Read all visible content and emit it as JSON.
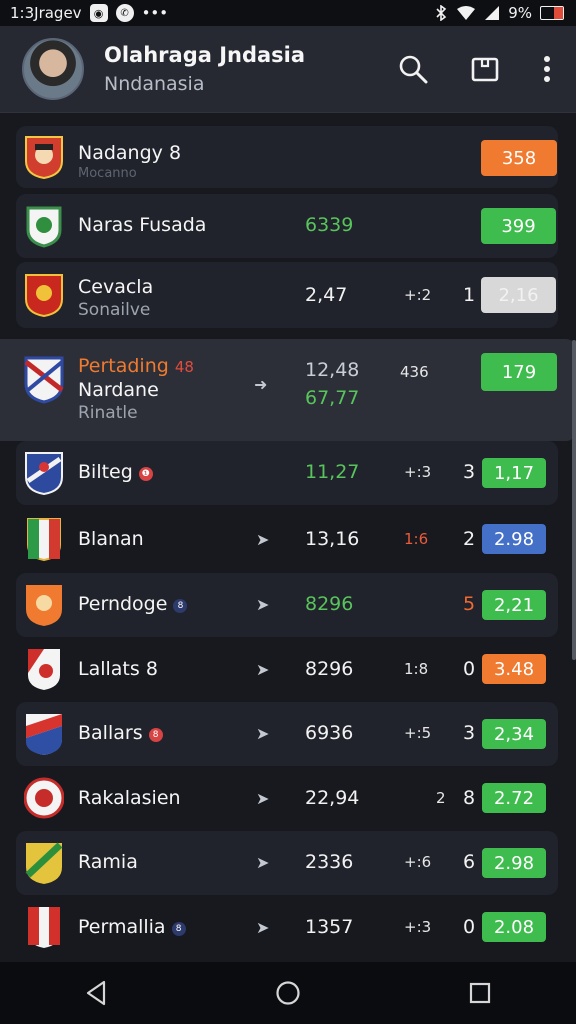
{
  "status_bar": {
    "time_text": "1:3Jragev",
    "battery_text": "9%",
    "icons": [
      "app-icon",
      "messenger-icon",
      "more-icon",
      "bluetooth-icon",
      "wifi-icon",
      "signal-icon",
      "battery-icon"
    ]
  },
  "header": {
    "title": "Olahraga Jndasia",
    "subtitle": "Nndanasia",
    "actions": [
      "search-icon",
      "bookmark-icon",
      "more-vert-icon"
    ]
  },
  "rows": [
    {
      "name": "Nadangy",
      "name_suffix": "8",
      "sub": "Mocanno",
      "pill": "358",
      "pill_color": "#f07a2f"
    },
    {
      "name": "Naras Fusada",
      "score": "6339",
      "pill": "399",
      "pill_color": "#3fbc4e"
    },
    {
      "name": "Cevacla",
      "sub": "Sonailve",
      "score": "2,47",
      "diff": "+:2",
      "rank": "1",
      "pill": "2,16",
      "pill_color": "#d8d8d8"
    },
    {
      "name": "Pertading",
      "name_suffix": "48",
      "name2": "Nardane",
      "sub": "Rinatle",
      "score": "12,48",
      "score2": "67,77",
      "diff": "436",
      "pill": "179",
      "pill_color": "#3fbc4e"
    },
    {
      "name": "Bilteg",
      "score": "11,27",
      "diff": "+:3",
      "rank": "3",
      "pill": "1,17",
      "pill_color": "#3fbc4e"
    },
    {
      "name": "Blanan",
      "score": "13,16",
      "diff": "1:6",
      "rank": "2",
      "pill": "2.98",
      "pill_color": "#4471c7"
    },
    {
      "name": "Perndoge",
      "score": "8296",
      "rank": "5",
      "pill": "2,21",
      "pill_color": "#3fbc4e"
    },
    {
      "name": "Lallats",
      "name_suffix": "8",
      "score": "8296",
      "diff": "1:8",
      "rank": "0",
      "pill": "3.48",
      "pill_color": "#f07a2f"
    },
    {
      "name": "Ballars",
      "score": "6936",
      "diff": "+:5",
      "rank": "3",
      "pill": "2,34",
      "pill_color": "#3fbc4e"
    },
    {
      "name": "Rakalasien",
      "score": "22,94",
      "diff": "2",
      "rank": "8",
      "pill": "2.72",
      "pill_color": "#3fbc4e"
    },
    {
      "name": "Ramia",
      "score": "2336",
      "diff": "+:6",
      "rank": "6",
      "pill": "2.98",
      "pill_color": "#3fbc4e"
    },
    {
      "name": "Permallia",
      "score": "1357",
      "diff": "+:3",
      "rank": "0",
      "pill": "2.08",
      "pill_color": "#3fbc4e"
    }
  ],
  "nav_bar": {
    "buttons": [
      "back-icon",
      "home-icon",
      "recents-icon"
    ]
  }
}
